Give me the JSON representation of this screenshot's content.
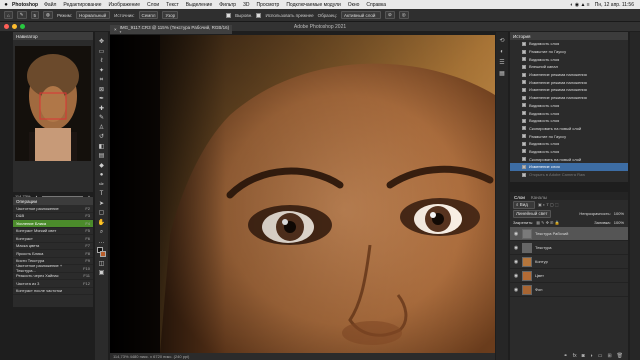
{
  "menubar": {
    "apple": "",
    "app": "Photoshop",
    "items": [
      "Файл",
      "Редактирование",
      "Изображение",
      "Слои",
      "Текст",
      "Выделение",
      "Фильтр",
      "3D",
      "Просмотр",
      "Подключаемые модули",
      "Окно",
      "Справка"
    ],
    "clock": "Пн, 12 апр.  11:56"
  },
  "options": {
    "mode_label": "Режим:",
    "mode_value": "Нормальный",
    "source_label": "Источник:",
    "source_sample": "Семпл",
    "source_pattern": "Узор",
    "aligned": "Выровн.",
    "use_legacy": "Использовать прежнее",
    "sample_label": "Образец:",
    "sample_value": "Активный слой",
    "diffusion_value": "5"
  },
  "window": {
    "title": "Adobe Photoshop 2021",
    "doc_tab": "IMG_9117.CR3 @ 115% (Текстура Рабочий, RGB/16) *",
    "status": "114,73%    4480 пикс. x 6720 пикс. (240 ppi)"
  },
  "navigator": {
    "title": "Навигатор",
    "zoom": "114,73%"
  },
  "actions": {
    "title": "Операции",
    "rows": [
      {
        "label": "Частотное разложение",
        "key": "F2"
      },
      {
        "label": "D&B",
        "key": "F3"
      },
      {
        "label": "Усиление Блика",
        "key": "F4",
        "selected": true
      },
      {
        "label": "Контраст Мягкий свет",
        "key": "F5"
      },
      {
        "label": "Контраст",
        "key": "F6"
      },
      {
        "label": "Маска цвета",
        "key": "F7"
      },
      {
        "label": "Яркость Блика",
        "key": "F8"
      },
      {
        "label": "Кисти Текстура",
        "key": "F9"
      },
      {
        "label": "Частотное разложение + Текстура...",
        "key": "F10"
      },
      {
        "label": "Резкость через Хайпас",
        "key": "F11"
      },
      {
        "label": "Частота из 3",
        "key": "F12"
      },
      {
        "label": "Контраст после частотки",
        "key": ""
      }
    ]
  },
  "history": {
    "title": "История",
    "rows": [
      {
        "label": "Видимость слоя"
      },
      {
        "label": "Размытие по Гауссу"
      },
      {
        "label": "Видимость слоя"
      },
      {
        "label": "Внешний канал"
      },
      {
        "label": "Изменение режима наложения"
      },
      {
        "label": "Изменение режима наложения"
      },
      {
        "label": "Изменение режима наложения"
      },
      {
        "label": "Изменение режима наложения"
      },
      {
        "label": "Видимость слоя"
      },
      {
        "label": "Видимость слоя"
      },
      {
        "label": "Видимость слоя"
      },
      {
        "label": "Скопировать на новый слой"
      },
      {
        "label": "Размытие по Гауссу"
      },
      {
        "label": "Видимость слоя"
      },
      {
        "label": "Видимость слоя"
      },
      {
        "label": "Скопировать на новый слой"
      },
      {
        "label": "Изменение слоя",
        "selected": true
      },
      {
        "label": "Открыть в Adobe Camera Raw",
        "dim": true
      }
    ]
  },
  "layers_panel": {
    "tab_layers": "Слои",
    "tab_channels": "Каналы",
    "filter": "Вид",
    "blend": "Линейный свет",
    "opacity_label": "Непрозрачность:",
    "opacity_value": "100%",
    "lock_label": "Закрепить:",
    "fill_label": "Заливка:",
    "fill_value": "100%",
    "layers": [
      {
        "name": "Текстура Рабочий",
        "selected": true,
        "thumb": "#7a7a7a"
      },
      {
        "name": "Текстура",
        "thumb": "#666666"
      },
      {
        "name": "Контур",
        "thumb": "#b5763c"
      },
      {
        "name": "Цвет",
        "thumb": "#b36b35"
      },
      {
        "name": "Фон",
        "thumb": "#a86532"
      }
    ]
  },
  "colors": {
    "selected_action": "#4b8b2b",
    "selected_history": "#3d6da4"
  }
}
